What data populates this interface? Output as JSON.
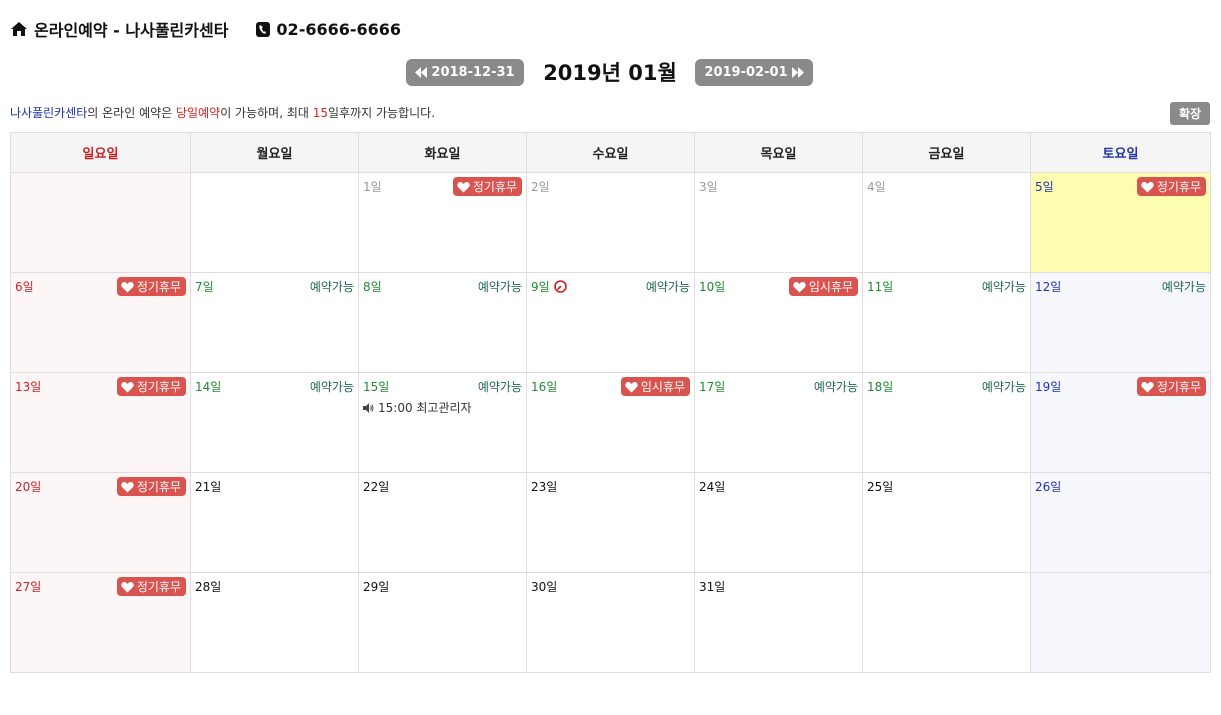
{
  "header": {
    "title": "온라인예약 - 나사풀린카센타",
    "phone": "02-6666-6666"
  },
  "nav": {
    "prev_label": "2018-12-31",
    "next_label": "2019-02-01",
    "month_title": "2019년 01월"
  },
  "notice": {
    "shop_name": "나사풀린카센타",
    "text1": "의 온라인 예약은 ",
    "same_day": "당일예약",
    "text2": "이 가능하며, 최대 ",
    "days": "15",
    "text3": "일후까지 가능합니다."
  },
  "expand_label": "확장",
  "weekdays": [
    "일요일",
    "월요일",
    "화요일",
    "수요일",
    "목요일",
    "금요일",
    "토요일"
  ],
  "labels": {
    "regular_holiday": "정기휴무",
    "temp_holiday": "임시휴무",
    "available": "예약가능"
  },
  "colors": {
    "holiday_badge": "#d9534f",
    "today_bg": "#fdfdb2",
    "button_gray": "#8a8a8a"
  },
  "weeks": [
    [
      {
        "day": ""
      },
      {
        "day": ""
      },
      {
        "day": "1일",
        "tone": "gray",
        "badge": "정기휴무"
      },
      {
        "day": "2일",
        "tone": "gray"
      },
      {
        "day": "3일",
        "tone": "gray"
      },
      {
        "day": "4일",
        "tone": "gray"
      },
      {
        "day": "5일",
        "tone": "blue",
        "badge": "정기휴무",
        "today": true
      }
    ],
    [
      {
        "day": "6일",
        "tone": "red",
        "badge": "정기휴무"
      },
      {
        "day": "7일",
        "tone": "green",
        "status": "예약가능"
      },
      {
        "day": "8일",
        "tone": "green",
        "status": "예약가능"
      },
      {
        "day": "9일",
        "tone": "green",
        "status": "예약가능",
        "clock": true
      },
      {
        "day": "10일",
        "tone": "green",
        "badge": "임시휴무"
      },
      {
        "day": "11일",
        "tone": "green",
        "status": "예약가능"
      },
      {
        "day": "12일",
        "tone": "blue",
        "status": "예약가능"
      }
    ],
    [
      {
        "day": "13일",
        "tone": "red",
        "badge": "정기휴무"
      },
      {
        "day": "14일",
        "tone": "green",
        "status": "예약가능"
      },
      {
        "day": "15일",
        "tone": "green",
        "status": "예약가능",
        "event": "15:00 최고관리자"
      },
      {
        "day": "16일",
        "tone": "green",
        "badge": "임시휴무"
      },
      {
        "day": "17일",
        "tone": "green",
        "status": "예약가능"
      },
      {
        "day": "18일",
        "tone": "green",
        "status": "예약가능"
      },
      {
        "day": "19일",
        "tone": "blue",
        "badge": "정기휴무"
      }
    ],
    [
      {
        "day": "20일",
        "tone": "red",
        "badge": "정기휴무"
      },
      {
        "day": "21일",
        "tone": "black"
      },
      {
        "day": "22일",
        "tone": "black"
      },
      {
        "day": "23일",
        "tone": "black"
      },
      {
        "day": "24일",
        "tone": "black"
      },
      {
        "day": "25일",
        "tone": "black"
      },
      {
        "day": "26일",
        "tone": "blue"
      }
    ],
    [
      {
        "day": "27일",
        "tone": "red",
        "badge": "정기휴무"
      },
      {
        "day": "28일",
        "tone": "black"
      },
      {
        "day": "29일",
        "tone": "black"
      },
      {
        "day": "30일",
        "tone": "black"
      },
      {
        "day": "31일",
        "tone": "black"
      },
      {
        "day": ""
      },
      {
        "day": ""
      }
    ]
  ]
}
